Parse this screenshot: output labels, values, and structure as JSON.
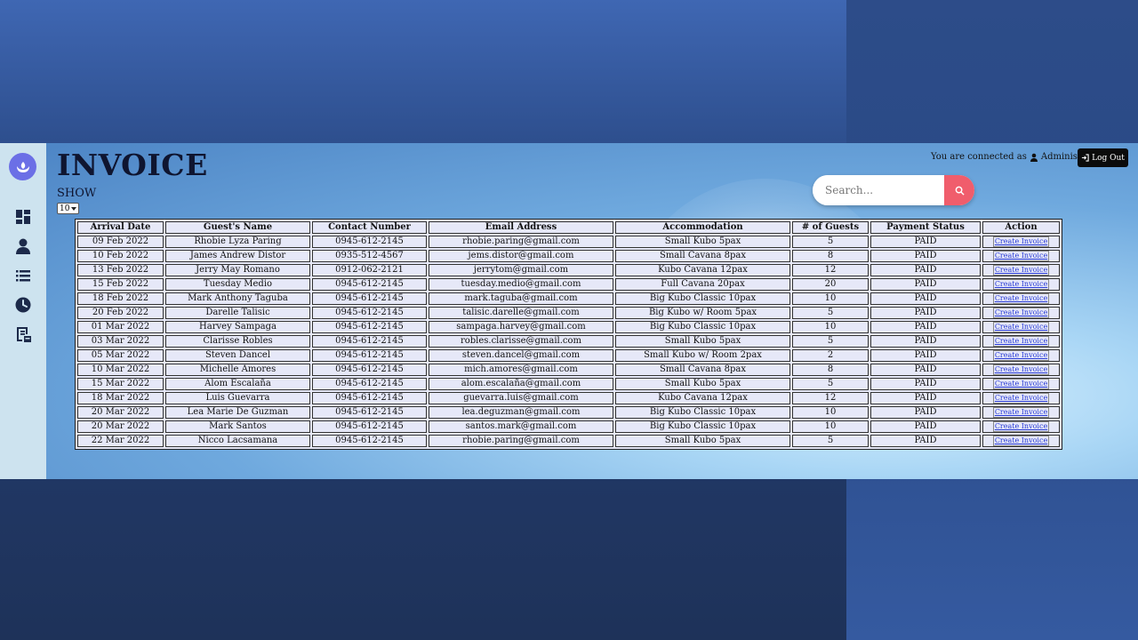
{
  "page_title": "INVOICE",
  "show": {
    "label": "SHOW",
    "value": "10"
  },
  "header": {
    "connected_text": "You are connected as",
    "user": "Administrator",
    "logout_label": "Log Out"
  },
  "search": {
    "placeholder": "Search..."
  },
  "sidebar": {
    "items": [
      {
        "icon": "dashboard-icon"
      },
      {
        "icon": "user-icon"
      },
      {
        "icon": "list-icon"
      },
      {
        "icon": "clock-icon"
      },
      {
        "icon": "invoice-icon"
      }
    ]
  },
  "table": {
    "headers": [
      "Arrival Date",
      "Guest's Name",
      "Contact Number",
      "Email Address",
      "Accommodation",
      "# of Guests",
      "Payment Status",
      "Action"
    ],
    "action_label": "Create Invoice",
    "rows": [
      [
        "09 Feb 2022",
        "Rhobie Lyza Paring",
        "0945-612-2145",
        "rhobie.paring@gmail.com",
        "Small Kubo 5pax",
        "5",
        "PAID"
      ],
      [
        "10 Feb 2022",
        "James Andrew Distor",
        "0935-512-4567",
        "jems.distor@gmail.com",
        "Small Cavana 8pax",
        "8",
        "PAID"
      ],
      [
        "13 Feb 2022",
        "Jerry May Romano",
        "0912-062-2121",
        "jerrytom@gmail.com",
        "Kubo Cavana 12pax",
        "12",
        "PAID"
      ],
      [
        "15 Feb 2022",
        "Tuesday Medio",
        "0945-612-2145",
        "tuesday.medio@gmail.com",
        "Full Cavana 20pax",
        "20",
        "PAID"
      ],
      [
        "18 Feb 2022",
        "Mark Anthony Taguba",
        "0945-612-2145",
        "mark.taguba@gmail.com",
        "Big Kubo Classic 10pax",
        "10",
        "PAID"
      ],
      [
        "20 Feb 2022",
        "Darelle Talisic",
        "0945-612-2145",
        "talisic.darelle@gmail.com",
        "Big Kubo w/ Room 5pax",
        "5",
        "PAID"
      ],
      [
        "01 Mar 2022",
        "Harvey Sampaga",
        "0945-612-2145",
        "sampaga.harvey@gmail.com",
        "Big Kubo Classic 10pax",
        "10",
        "PAID"
      ],
      [
        "03 Mar 2022",
        "Clarisse Robles",
        "0945-612-2145",
        "robles.clarisse@gmail.com",
        "Small Kubo 5pax",
        "5",
        "PAID"
      ],
      [
        "05 Mar 2022",
        "Steven Dancel",
        "0945-612-2145",
        "steven.dancel@gmail.com",
        "Small Kubo w/ Room 2pax",
        "2",
        "PAID"
      ],
      [
        "10 Mar 2022",
        "Michelle Amores",
        "0945-612-2145",
        "mich.amores@gmail.com",
        "Small Cavana 8pax",
        "8",
        "PAID"
      ],
      [
        "15 Mar 2022",
        "Alom Escalaña",
        "0945-612-2145",
        "alom.escalaña@gmail.com",
        "Small Kubo 5pax",
        "5",
        "PAID"
      ],
      [
        "18 Mar 2022",
        "Luis Guevarra",
        "0945-612-2145",
        "guevarra.luis@gmail.com",
        "Kubo Cavana 12pax",
        "12",
        "PAID"
      ],
      [
        "20 Mar 2022",
        "Lea Marie De Guzman",
        "0945-612-2145",
        "lea.deguzman@gmail.com",
        "Big Kubo Classic 10pax",
        "10",
        "PAID"
      ],
      [
        "20 Mar 2022",
        "Mark Santos",
        "0945-612-2145",
        "santos.mark@gmail.com",
        "Big Kubo Classic 10pax",
        "10",
        "PAID"
      ],
      [
        "22 Mar 2022",
        "Nicco Lacsamana",
        "0945-612-2145",
        "rhobie.paring@gmail.com",
        "Small Kubo 5pax",
        "5",
        "PAID"
      ]
    ]
  },
  "colors": {
    "accent": "#6b6fe6",
    "search_button": "#f05d6c",
    "logout_bg": "#0b0b0b",
    "sidebar_bg": "#cde3ef",
    "table_bg": "#e6e8f8"
  }
}
